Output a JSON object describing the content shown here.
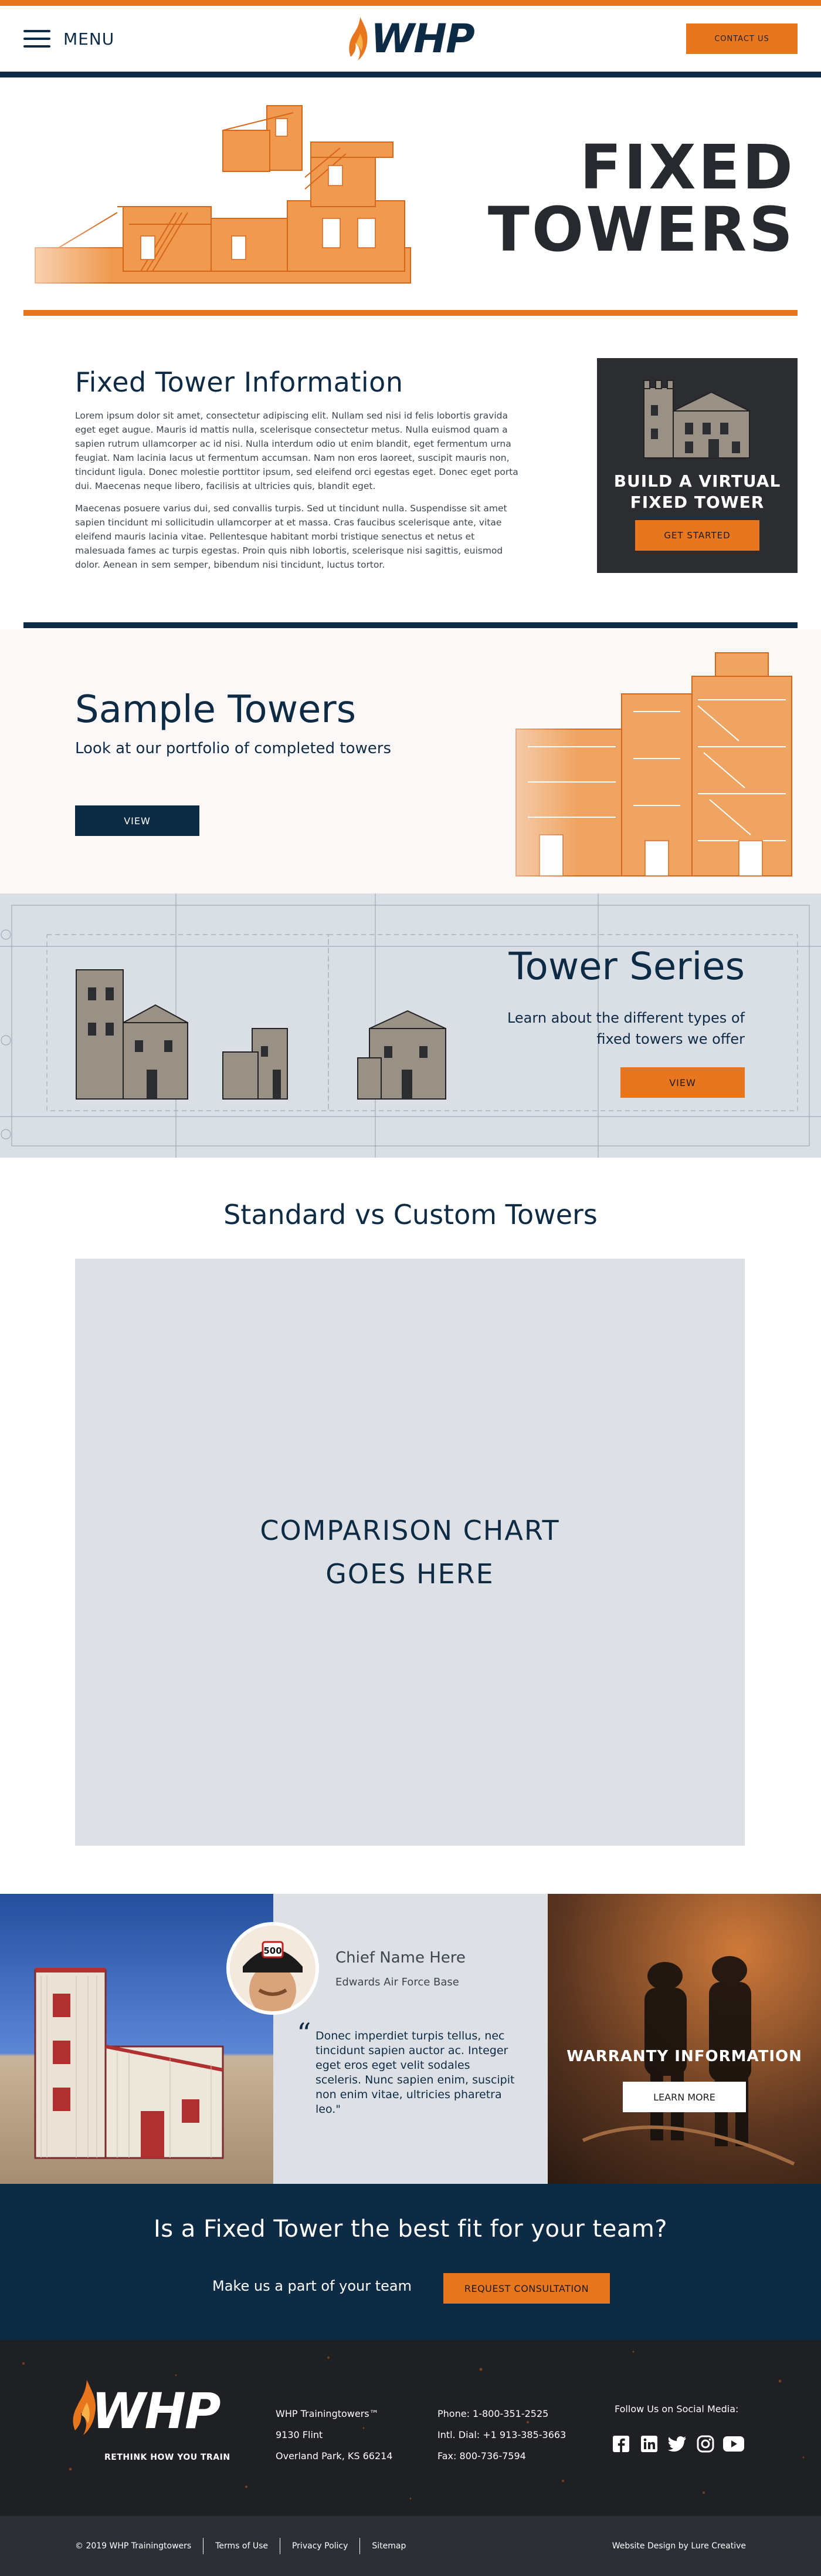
{
  "header": {
    "menu_label": "MENU",
    "logo_text": "WHP",
    "contact_label": "CONTACT US"
  },
  "hero": {
    "title_line1": "FIXED",
    "title_line2": "TOWERS"
  },
  "info": {
    "heading": "Fixed Tower Information",
    "paragraph1": "Lorem ipsum dolor sit amet, consectetur adipiscing elit. Nullam sed nisi id felis lobortis gravida eget eget augue. Mauris id mattis nulla, scelerisque consectetur metus. Nulla euismod quam a sapien rutrum ullamcorper ac id nisi. Nulla interdum odio ut enim blandit, eget fermentum urna feugiat. Nam lacinia lacus ut fermentum accumsan. Nam non eros laoreet, suscipit mauris non, tincidunt ligula. Donec molestie porttitor ipsum, sed eleifend orci egestas eget. Donec eget porta dui. Maecenas neque libero, facilisis at ultricies quis, blandit eget.",
    "paragraph2": "Maecenas posuere varius dui, sed convallis turpis. Sed ut tincidunt nulla. Suspendisse sit amet sapien tincidunt mi sollicitudin ullamcorper at et massa. Cras faucibus scelerisque ante, vitae eleifend mauris lacinia vitae. Pellentesque habitant morbi tristique senectus et netus et malesuada fames ac turpis egestas. Proin quis nibh lobortis, scelerisque nisi sagittis, euismod dolor. Aenean in sem semper, bibendum nisi tincidunt, luctus tortor.",
    "build_title_line1": "BUILD A VIRTUAL",
    "build_title_line2": "FIXED TOWER",
    "get_started_label": "GET STARTED"
  },
  "sample": {
    "heading": "Sample Towers",
    "subtitle": "Look at our portfolio of completed towers",
    "view_label": "VIEW"
  },
  "series": {
    "heading": "Tower Series",
    "subtitle": "Learn about the different types of fixed towers we offer",
    "view_label": "VIEW"
  },
  "compare": {
    "heading": "Standard vs Custom Towers",
    "placeholder": "COMPARISON CHART\nGOES HERE"
  },
  "testimonial": {
    "badge_number": "500",
    "name": "Chief Name Here",
    "org": "Edwards Air Force Base",
    "quote": "Donec imperdiet turpis tellus, nec tincidunt sapien auctor ac. Integer eget eros eget velit sodales sceleris. Nunc sapien enim, suscipit non enim vitae, ultricies pharetra leo.\""
  },
  "warranty": {
    "title": "WARRANTY INFORMATION",
    "button_label": "LEARN MORE"
  },
  "cta": {
    "heading": "Is a Fixed Tower the best fit for your team?",
    "subtitle": "Make us a part of your team",
    "button_label": "REQUEST CONSULTATION"
  },
  "footer": {
    "logo_text": "WHP",
    "tagline": "RETHINK HOW YOU TRAIN",
    "address_lines": [
      "WHP Trainingtowers™",
      "9130 Flint",
      "Overland Park, KS 66214"
    ],
    "contact_lines": [
      "Phone: 1-800-351-2525",
      "Intl. Dial: +1 913-385-3663",
      "Fax: 800-736-7594"
    ],
    "social_title": "Follow Us on Social Media:",
    "social_icons": [
      "facebook-icon",
      "linkedin-icon",
      "twitter-icon",
      "instagram-icon",
      "youtube-icon"
    ]
  },
  "subfooter": {
    "copyright": "© 2019 WHP Trainingtowers",
    "links": [
      "Terms of Use",
      "Privacy Policy",
      "Sitemap"
    ],
    "credit": "Website Design by Lure Creative"
  },
  "colors": {
    "accent_orange": "#e8761f",
    "navy": "#0e2b45",
    "dark": "#2b2d31"
  }
}
